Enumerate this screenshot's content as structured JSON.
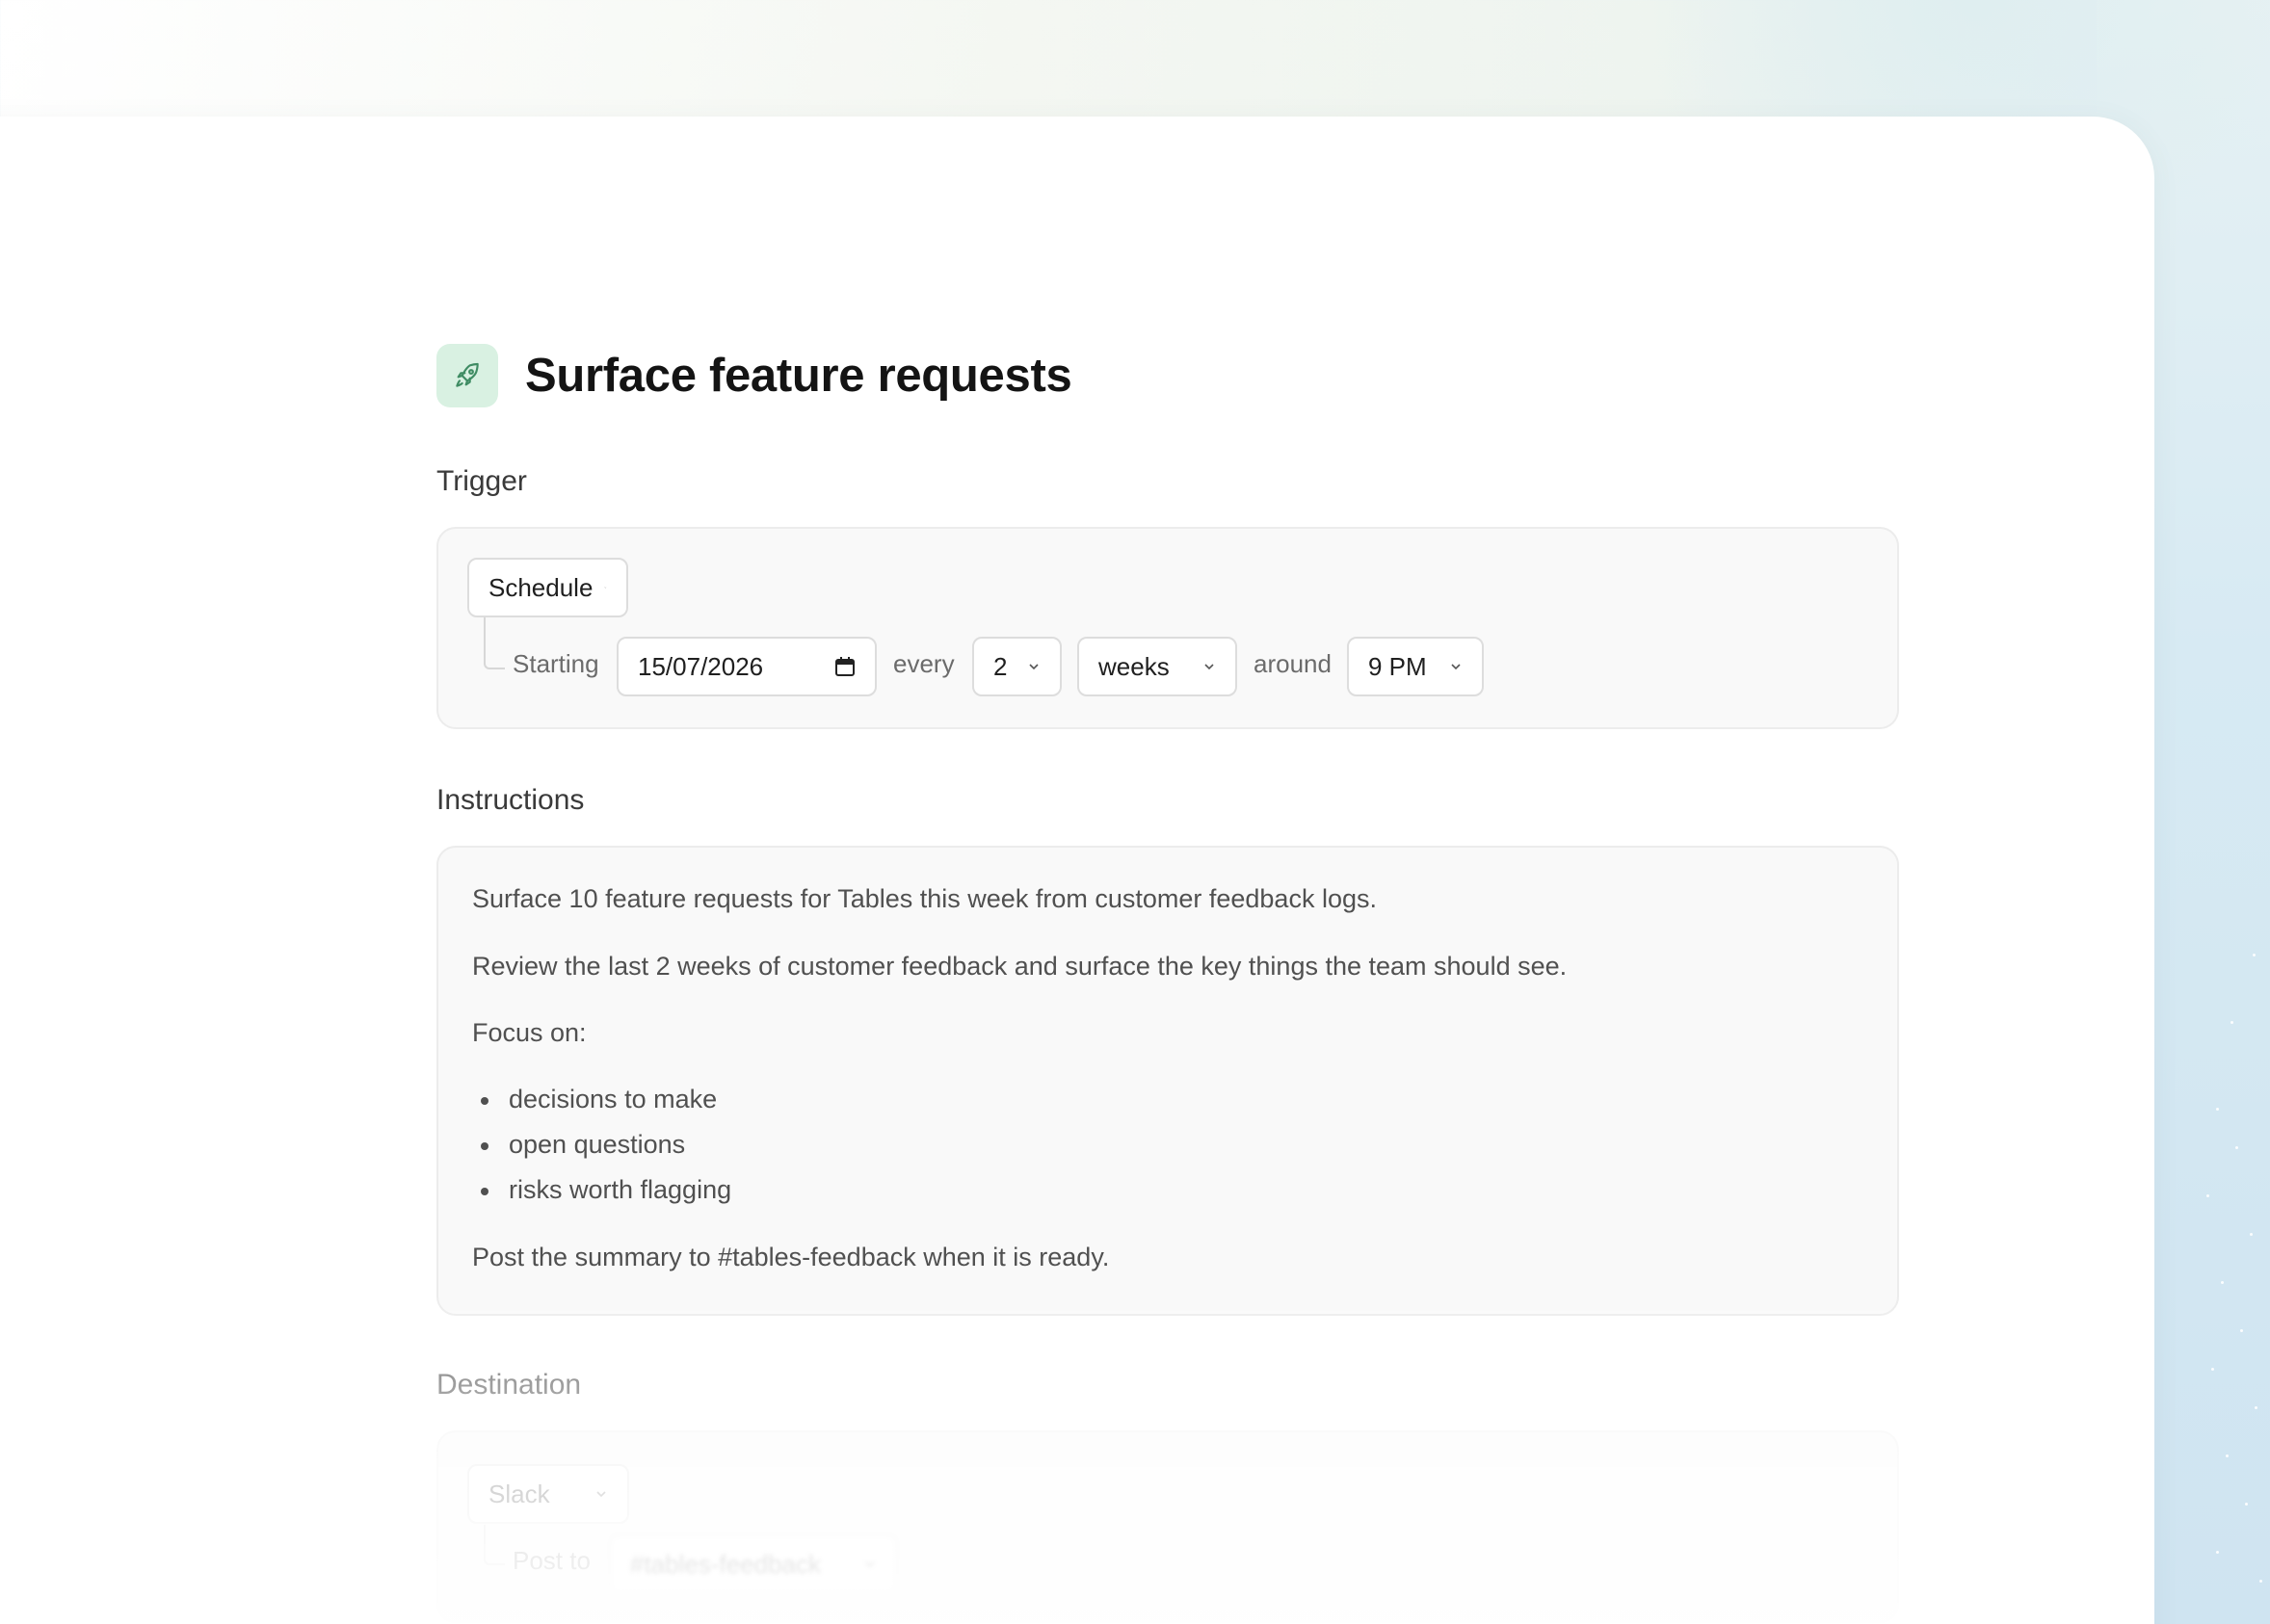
{
  "page": {
    "title": "Surface feature requests",
    "icon": "rocket-icon",
    "accent_color": "#d9f1e2"
  },
  "trigger": {
    "section_label": "Trigger",
    "type_select": "Schedule",
    "starting_label": "Starting",
    "start_date": "15/07/2026",
    "every_label": "every",
    "interval_value": "2",
    "interval_unit": "weeks",
    "around_label": "around",
    "time_value": "9 PM"
  },
  "instructions": {
    "section_label": "Instructions",
    "line1": "Surface 10 feature requests for Tables this week from customer feedback logs.",
    "line2": "Review the last 2 weeks of customer feedback and surface the key things the team should see.",
    "focus_label": "Focus on:",
    "bullets": [
      "decisions to make",
      "open questions",
      "risks worth flagging"
    ],
    "closing": "Post the summary to #tables-feedback when it is ready."
  },
  "destination": {
    "section_label": "Destination",
    "type_select": "Slack",
    "post_to_label": "Post to",
    "channel": "#tables-feedback"
  }
}
